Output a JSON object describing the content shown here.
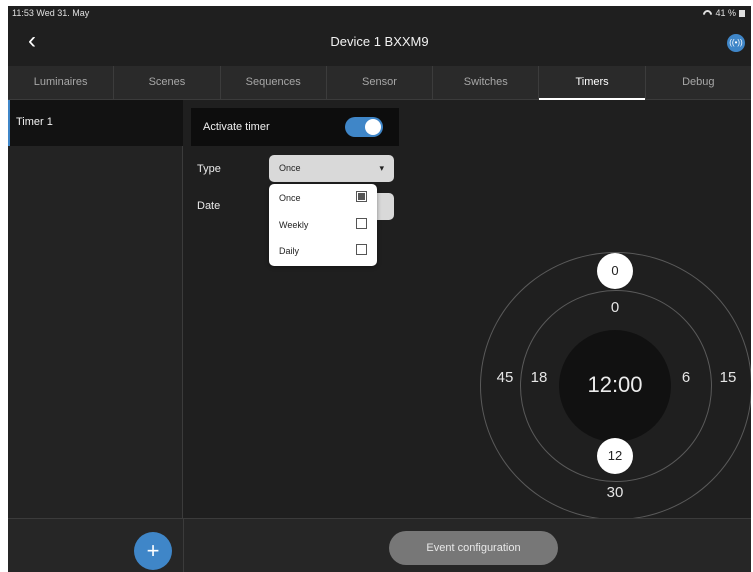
{
  "status_bar": {
    "time": "11:53",
    "date": "Wed 31. May",
    "battery": "41 %"
  },
  "header": {
    "back_glyph": "‹",
    "title": "Device 1 BXXM9",
    "badge_glyph": "((•))"
  },
  "tabs": [
    {
      "label": "Luminaires",
      "active": false
    },
    {
      "label": "Scenes",
      "active": false
    },
    {
      "label": "Sequences",
      "active": false
    },
    {
      "label": "Sensor",
      "active": false
    },
    {
      "label": "Switches",
      "active": false
    },
    {
      "label": "Timers",
      "active": true
    },
    {
      "label": "Debug",
      "active": false
    }
  ],
  "sidebar": {
    "items": [
      {
        "label": "Timer 1",
        "selected": true
      }
    ]
  },
  "form": {
    "activate_label": "Activate timer",
    "activate_on": true,
    "type_label": "Type",
    "type_value": "Once",
    "type_caret": "▾",
    "date_label": "Date",
    "type_options": [
      {
        "label": "Once",
        "checked": true
      },
      {
        "label": "Weekly",
        "checked": false
      },
      {
        "label": "Daily",
        "checked": false
      }
    ]
  },
  "clock": {
    "time": "12:00",
    "minute_labels": {
      "top": "0",
      "right": "15",
      "bottom": "30",
      "left": "45"
    },
    "hour_labels": {
      "top": "0",
      "right": "6",
      "left": "18"
    },
    "selected_hour": "12",
    "selected_minute": "0"
  },
  "bottom": {
    "add_glyph": "+",
    "event_button_label": "Event configuration"
  },
  "colors": {
    "accent": "#3f86c8",
    "background": "#1f1f1f",
    "sidebar_selected": "#121212"
  }
}
